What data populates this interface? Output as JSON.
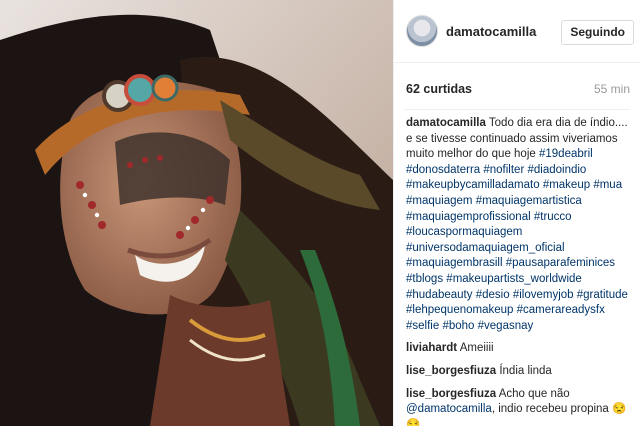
{
  "post": {
    "username": "damatocamilla",
    "follow_button": "Seguindo",
    "likes": "62 curtidas",
    "time": "55 min",
    "caption_text": "Todo dia era dia de índio.... e se tivesse continuado assim viveriamos muito melhor do que hoje",
    "hashtags": [
      "#19deabril",
      "#donosdaterra",
      "#nofilter",
      "#diadoindio",
      "#makeupbycamilladamato",
      "#makeup",
      "#mua",
      "#maquiagem",
      "#maquiagemartistica",
      "#maquiagemprofissional",
      "#trucco",
      "#loucaspormaquiagem",
      "#universodamaquiagem_oficial",
      "#maquiagembrasill",
      "#pausaparafeminices",
      "#tblogs",
      "#makeupartists_worldwide",
      "#hudabeauty",
      "#desio",
      "#ilovemyjob",
      "#gratitude",
      "#lehpequenomakeup",
      "#camerareadysfx",
      "#selfie",
      "#boho",
      "#vegasnay"
    ]
  },
  "comments": [
    {
      "user": "liviahardt",
      "text": "Ameiiii"
    },
    {
      "user": "lise_borgesfiuza",
      "text": "Índia linda"
    },
    {
      "user": "lise_borgesfiuza",
      "text_before": "Acho que não",
      "mention": "@damatocamilla",
      "text_after": ", indio recebeu propina 😒😒"
    }
  ],
  "icons": {
    "photo": "selfie-photo",
    "avatar": "user-avatar"
  }
}
